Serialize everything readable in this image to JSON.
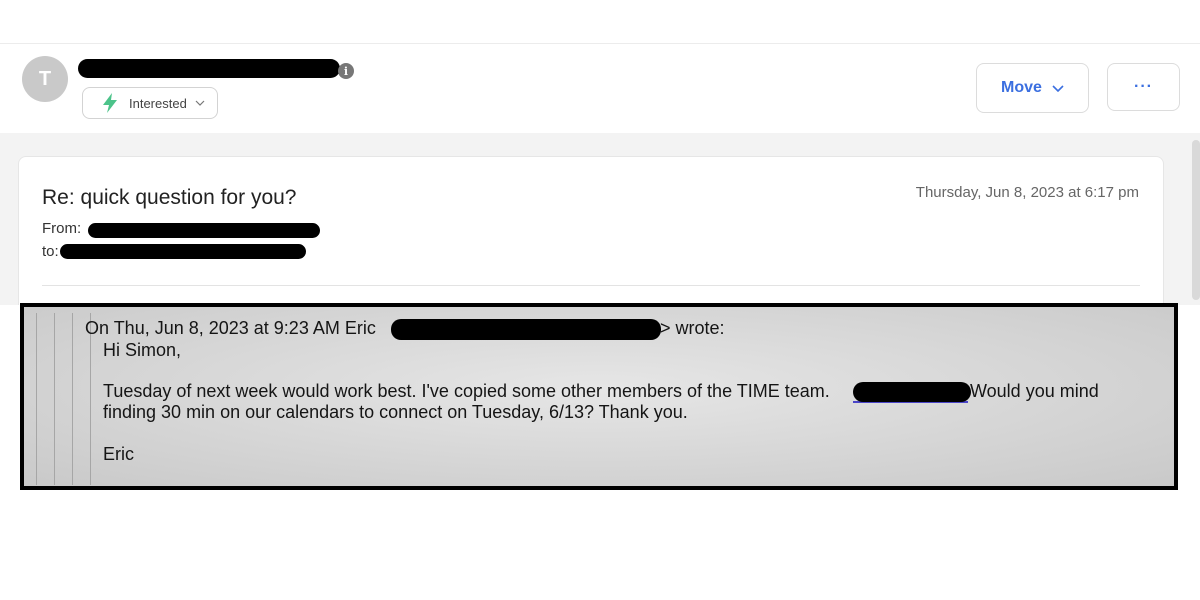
{
  "header": {
    "avatar_letter": "T",
    "status_label": "Interested",
    "move_label": "Move",
    "more_label": "···"
  },
  "message": {
    "subject": "Re: quick question for you?",
    "date": "Thursday, Jun 8, 2023 at 6:17 pm",
    "from_label": "From:",
    "to_label": "to:"
  },
  "quote": {
    "attribution_prefix": "On Thu, Jun 8, 2023 at 9:23 AM Eric",
    "attribution_suffix": "> wrote:",
    "greeting": "Hi Simon,",
    "body_line1_start": "Tuesday of next week would work best. I've copied some other members of the TIME team.",
    "body_line1_end": "Would you mind",
    "body_line2": "finding 30 min on our calendars to connect on Tuesday, 6/13? Thank you.",
    "signature": "Eric"
  },
  "colors": {
    "accent": "#3b6fe0",
    "status_icon": "#4cc38a",
    "redaction": "#000000",
    "quote_background": "#d6d6d6"
  }
}
